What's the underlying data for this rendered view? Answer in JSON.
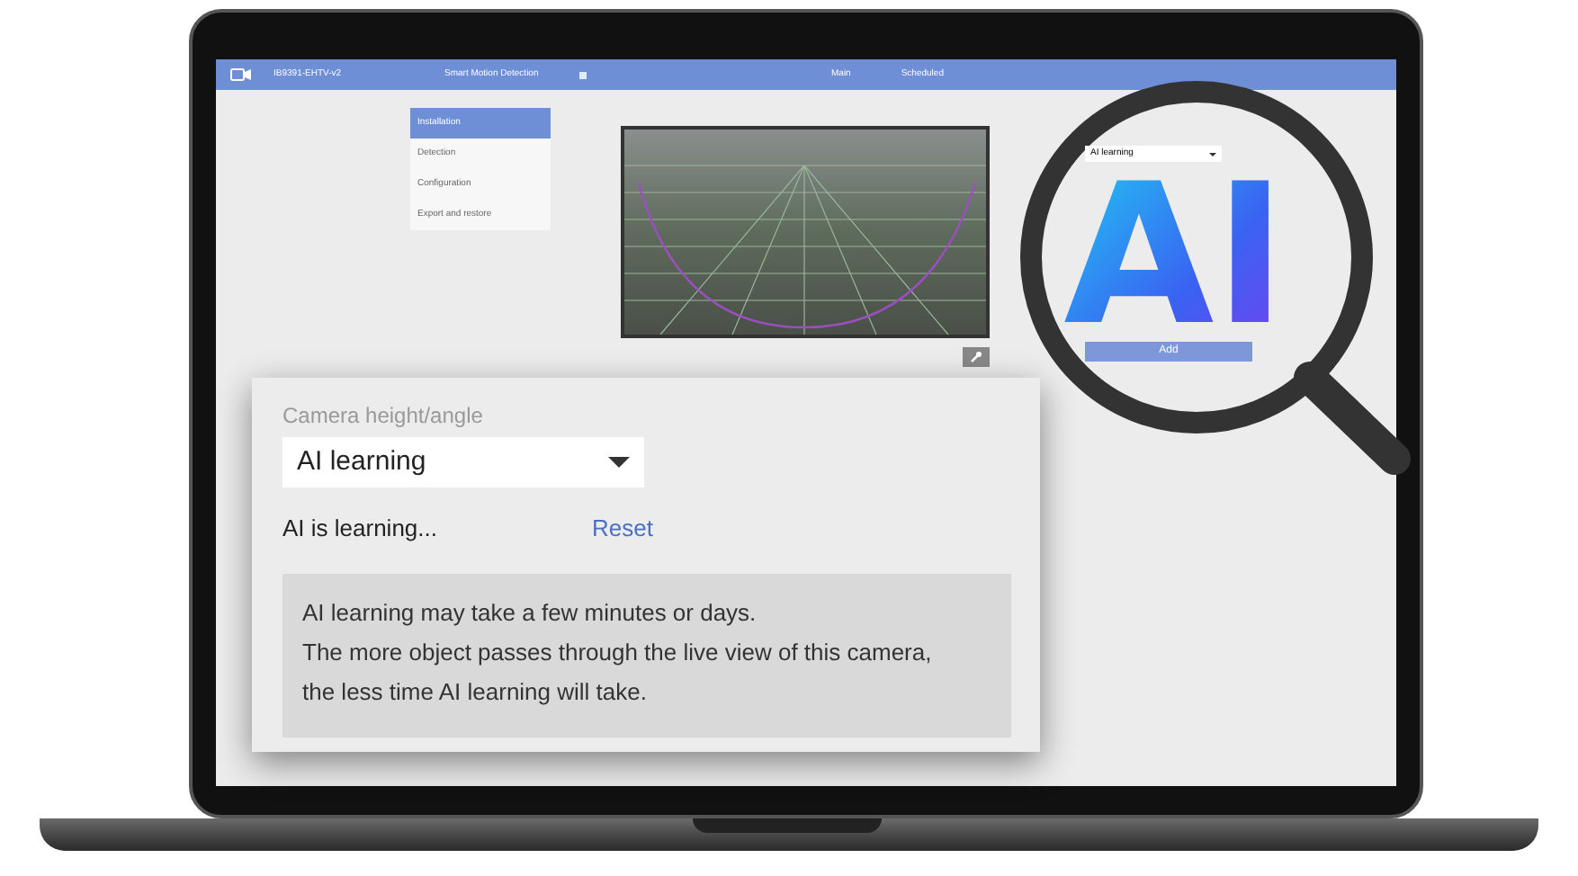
{
  "app_bar": {
    "device": "IB9391-EHTV-v2",
    "feature_tab": "Smart Motion Detection",
    "stream_tabs": [
      "Main",
      "Scheduled"
    ]
  },
  "sidebar": {
    "items": [
      {
        "label": "Installation",
        "selected": true
      },
      {
        "label": "Detection",
        "selected": false
      },
      {
        "label": "Configuration",
        "selected": false
      },
      {
        "label": "Export and restore",
        "selected": false
      }
    ]
  },
  "magnifier": {
    "dropdown": "AI learning",
    "logo": "AI",
    "button": "Add"
  },
  "callout": {
    "field_label": "Camera height/angle",
    "dropdown": "AI learning",
    "status": "AI is learning...",
    "link": "Reset",
    "info": [
      "AI learning may take a few minutes or days.",
      "The more object passes through the live view of this camera,",
      "the less time AI learning will take."
    ]
  }
}
